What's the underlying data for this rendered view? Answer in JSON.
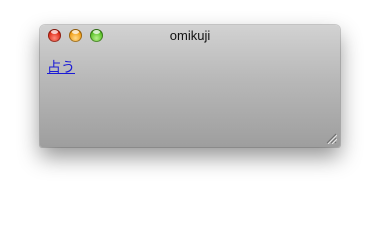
{
  "window": {
    "title": "omikuji"
  },
  "main": {
    "fortune_link_label": "占う"
  },
  "colors": {
    "link": "#1b1bd6",
    "close_button": "#e0301c",
    "minimize_button": "#f2a019",
    "zoom_button": "#5cc22a"
  },
  "icons": [
    "close-button-icon",
    "minimize-button-icon",
    "zoom-button-icon",
    "resize-grip-icon"
  ]
}
